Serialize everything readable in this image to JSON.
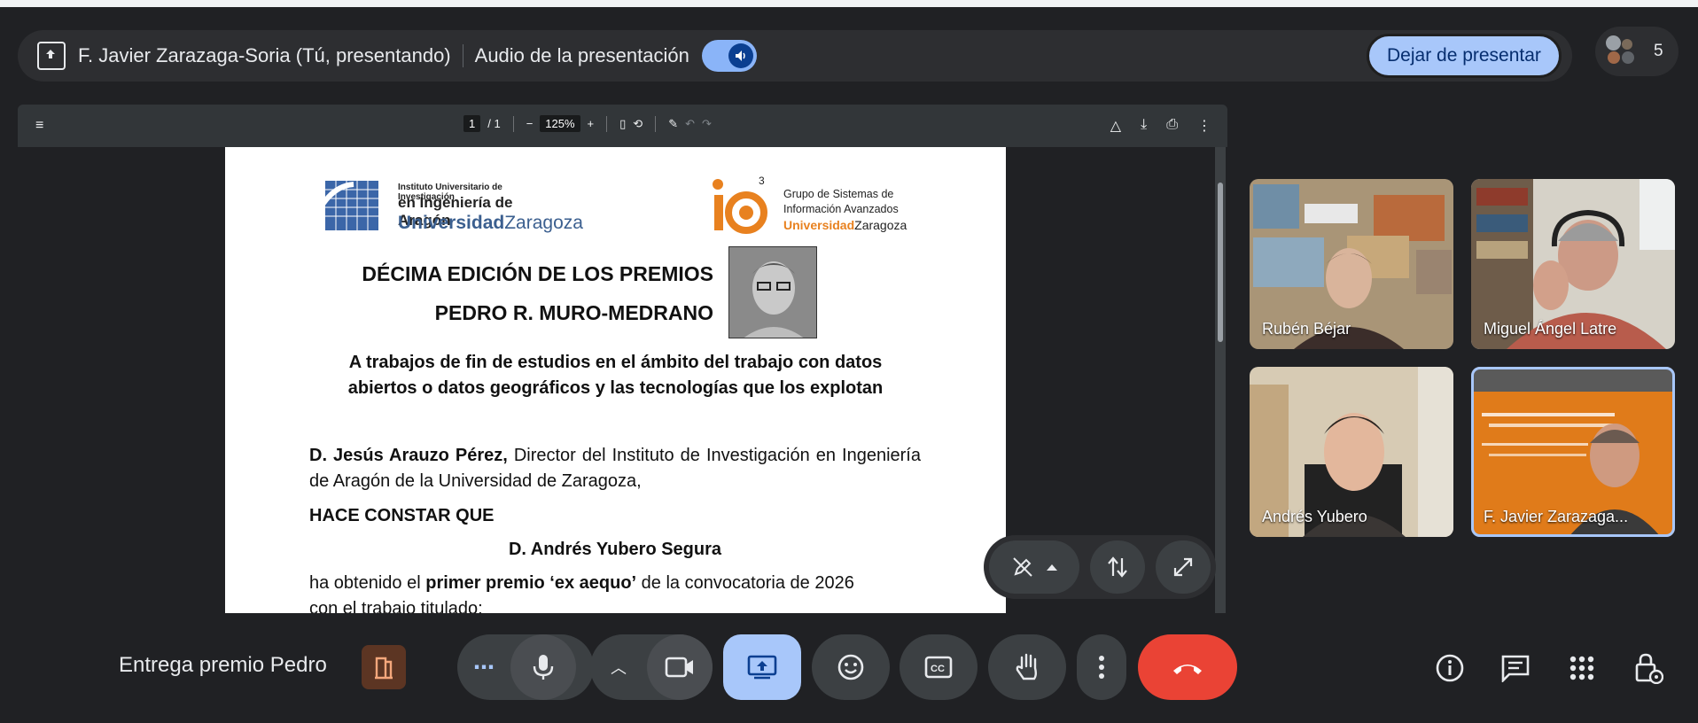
{
  "presenting_bar": {
    "presenter": "F. Javier Zarazaga-Soria (Tú, presentando)",
    "audio_label": "Audio de la presentación",
    "stop_button": "Dejar de presentar",
    "participant_count": "5"
  },
  "pdf_viewer": {
    "page_current": "1",
    "page_total": "/ 1",
    "zoom": "125%"
  },
  "document": {
    "logo1_line1": "Instituto Universitario de Investigación",
    "logo1_line2": "en Ingeniería de Aragón",
    "logo1_line3a": "Universidad",
    "logo1_line3b": "Zaragoza",
    "logo2_line1": "Grupo de Sistemas de",
    "logo2_line2": "Información Avanzados",
    "logo2_line3a": "Universidad",
    "logo2_line3b": "Zaragoza",
    "title_line1": "DÉCIMA EDICIÓN DE LOS PREMIOS",
    "title_line2": "PEDRO R. MURO-MEDRANO",
    "subtitle_line1": "A trabajos de fin de estudios en el ámbito del trabajo con datos",
    "subtitle_line2": "abiertos o datos geográficos y las tecnologías que los explotan",
    "para1_name": "D. Jesús Arauzo Pérez,",
    "para1_rest": " Director del Instituto de Investigación en Ingeniería de Aragón de la Universidad de Zaragoza,",
    "hace_constar": "HACE CONSTAR QUE",
    "winner": "D. Andrés Yubero Segura",
    "para2_a": "ha obtenido el ",
    "para2_b": "primer premio ‘ex aequo’",
    "para2_c": " de la convocatoria de 2026",
    "para3": "con el trabajo titulado:"
  },
  "participants": [
    {
      "name": "Rubén Béjar"
    },
    {
      "name": "Miguel Ángel Latre"
    },
    {
      "name": "Andrés Yubero"
    },
    {
      "name": "F. Javier Zarazaga..."
    }
  ],
  "meeting": {
    "title": "Entrega premio Pedro"
  },
  "icons": [
    "present-icon",
    "audio-icon",
    "menu-icon",
    "mic-icon",
    "camera-icon",
    "present-screen-icon",
    "emoji-icon",
    "captions-icon",
    "raise-hand-icon",
    "more-icon",
    "end-call-icon",
    "info-icon",
    "chat-icon",
    "apps-icon",
    "host-controls-icon"
  ],
  "colors": {
    "accent": "#a8c7fa",
    "end_call": "#ea4335",
    "background": "#202124"
  }
}
